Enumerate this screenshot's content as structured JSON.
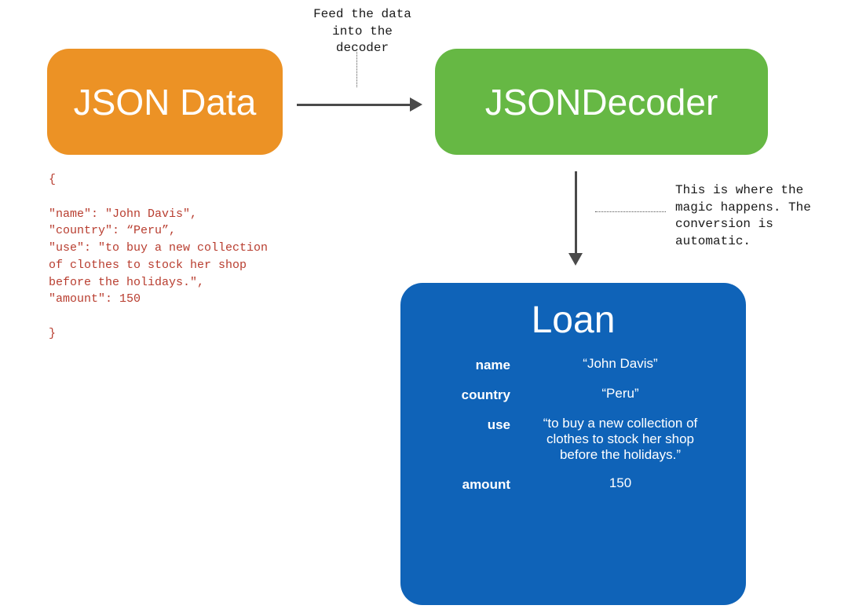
{
  "boxes": {
    "json": "JSON Data",
    "decoder": "JSONDecoder",
    "loan_title": "Loan"
  },
  "annotations": {
    "feed": "Feed the data into the decoder",
    "magic": "This is where the magic happens. The conversion is automatic."
  },
  "code": {
    "open": "{",
    "l1": "\"name\": \"John Davis\",",
    "l2": "\"country\": “Peru”,",
    "l3": "\"use\": \"to buy a new collection of clothes to stock her shop before the holidays.\",",
    "l4": "\"amount\": 150",
    "close": "}"
  },
  "loan": {
    "keys": {
      "name": "name",
      "country": "country",
      "use": "use",
      "amount": "amount"
    },
    "vals": {
      "name": "“John Davis”",
      "country": "“Peru”",
      "use": "“to buy a new collection of clothes to stock her shop before the holidays.”",
      "amount": "150"
    }
  },
  "colors": {
    "orange": "#ec9225",
    "green": "#66b844",
    "blue": "#0f63b8",
    "code_red": "#b83d2f",
    "arrow": "#4a4a4a"
  }
}
